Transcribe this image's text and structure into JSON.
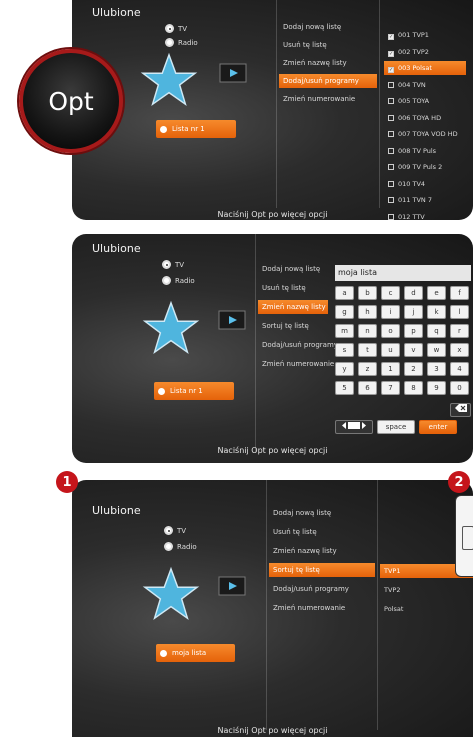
{
  "screens": [
    {
      "title": "Ulubione",
      "radios": [
        {
          "label": "TV",
          "selected": true
        },
        {
          "label": "Radio",
          "selected": false
        }
      ],
      "list_button": "Lista nr 1",
      "menu": [
        "Dodaj nową listę",
        "Usuń tę listę",
        "Zmień nazwę listy",
        "Dodaj/usuń programy",
        "Zmień numerowanie"
      ],
      "active_menu_index": 3,
      "channels": [
        {
          "label": "001 TVP1",
          "checked": true
        },
        {
          "label": "002 TVP2",
          "checked": true
        },
        {
          "label": "003 Polsat",
          "checked": true
        },
        {
          "label": "004 TVN",
          "checked": false
        },
        {
          "label": "005 TOYA",
          "checked": false
        },
        {
          "label": "006 TOYA HD",
          "checked": false
        },
        {
          "label": "007 TOYA VOD HD",
          "checked": false
        },
        {
          "label": "008 TV Puls",
          "checked": false
        },
        {
          "label": "009 TV Puls 2",
          "checked": false
        },
        {
          "label": "010 TV4",
          "checked": false
        },
        {
          "label": "011 TVN 7",
          "checked": false
        },
        {
          "label": "012 TTV",
          "checked": false
        }
      ],
      "active_channel_index": 2,
      "footer": "Naciśnij Opt po więcej opcji"
    },
    {
      "title": "Ulubione",
      "radios": [
        {
          "label": "TV",
          "selected": true
        },
        {
          "label": "Radio",
          "selected": false
        }
      ],
      "list_button": "Lista nr 1",
      "menu": [
        "Dodaj nową listę",
        "Usuń tę listę",
        "Zmień nazwę listy",
        "Sortuj tę listę",
        "Dodaj/usuń programy",
        "Zmień numerowanie"
      ],
      "active_menu_index": 2,
      "keyboard": {
        "input_value": "moja lista",
        "rows": [
          [
            "a",
            "b",
            "c",
            "d",
            "e",
            "f"
          ],
          [
            "g",
            "h",
            "i",
            "j",
            "k",
            "l"
          ],
          [
            "m",
            "n",
            "o",
            "p",
            "q",
            "r"
          ],
          [
            "s",
            "t",
            "u",
            "v",
            "w",
            "x"
          ],
          [
            "y",
            "z",
            "1",
            "2",
            "3",
            "4"
          ],
          [
            "5",
            "6",
            "7",
            "8",
            "9",
            "0"
          ]
        ],
        "space_label": "space",
        "enter_label": "enter"
      },
      "footer": "Naciśnij Opt po więcej opcji"
    },
    {
      "title": "Ulubione",
      "radios": [
        {
          "label": "TV",
          "selected": true
        },
        {
          "label": "Radio",
          "selected": false
        }
      ],
      "list_button": "moja lista",
      "menu": [
        "Dodaj nową listę",
        "Usuń tę listę",
        "Zmień nazwę listy",
        "Sortuj tę listę",
        "Dodaj/usuń programy",
        "Zmień numerowanie"
      ],
      "active_menu_index": 3,
      "sort_list": [
        "TVP1",
        "TVP2",
        "Polsat"
      ],
      "active_sort_index": 0,
      "footer": "Naciśnij Opt po więcej opcji"
    }
  ],
  "opt_button_label": "Opt",
  "badges": [
    "1",
    "2"
  ],
  "colors": {
    "accent": "#f0761a",
    "badge": "#c5151b",
    "opt_ring": "#a71a1a"
  }
}
